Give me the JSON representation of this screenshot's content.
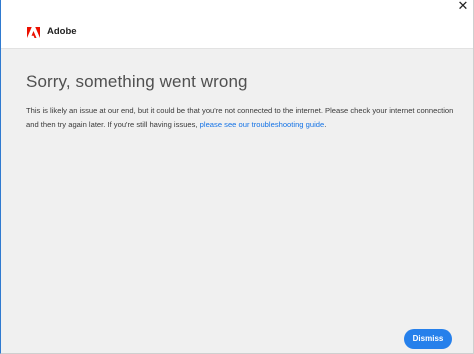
{
  "window": {
    "close_glyph": "✕"
  },
  "header": {
    "brand": "Adobe",
    "logo_icon": "adobe-logo-icon",
    "brand_color": "#eb1000"
  },
  "error": {
    "title": "Sorry, something went wrong",
    "message": "This is likely an issue at our end, but it could be that you're not connected to the internet. Please check your internet connection and then try again later. If you're still having issues, ",
    "link_text": "please see our troubleshooting guide",
    "message_end": "."
  },
  "actions": {
    "dismiss_label": "Dismiss",
    "accent_color": "#2680eb"
  }
}
